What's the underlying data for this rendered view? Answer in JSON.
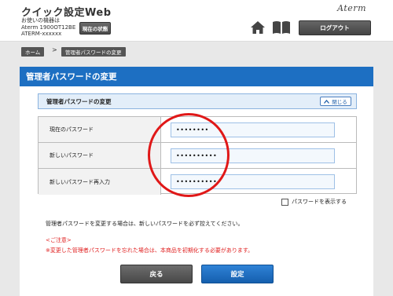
{
  "header": {
    "app_title": "クイック設定Web",
    "device_info_line1": "お使いの機器は",
    "device_info_line2": "Aterm 1900OT12BE",
    "device_info_line3": "ATERM-xxxxxx",
    "status_button": "現在の状態",
    "brand": "Aterm",
    "logout_button": "ログアウト",
    "home_icon": "home-icon",
    "manual_icon": "book-icon"
  },
  "breadcrumb": {
    "home": "ホーム",
    "separator": ">",
    "current": "管理者パスワードの変更"
  },
  "page": {
    "heading": "管理者パスワードの変更",
    "section_title": "管理者パスワードの変更",
    "collapse_label": "閉じる"
  },
  "form": {
    "rows": [
      {
        "label": "現在のパスワード",
        "value": "••••••••"
      },
      {
        "label": "新しいパスワード",
        "value": "••••••••••"
      },
      {
        "label": "新しいパスワード再入力",
        "value": "••••••••••"
      }
    ],
    "show_password_label": "パスワードを表示する"
  },
  "notes": {
    "notice": "管理者パスワードを変更する場合は、新しいパスワードを必ず控えてください。",
    "caution_head": "<ご注意>",
    "caution_text": "※変更した管理者パスワードを忘れた場合は、本商品を初期化する必要があります。"
  },
  "buttons": {
    "back": "戻る",
    "submit": "設定"
  },
  "colors": {
    "accent_blue": "#1d6fc2",
    "highlight_red": "#e01818",
    "caution_red": "#e02020"
  }
}
